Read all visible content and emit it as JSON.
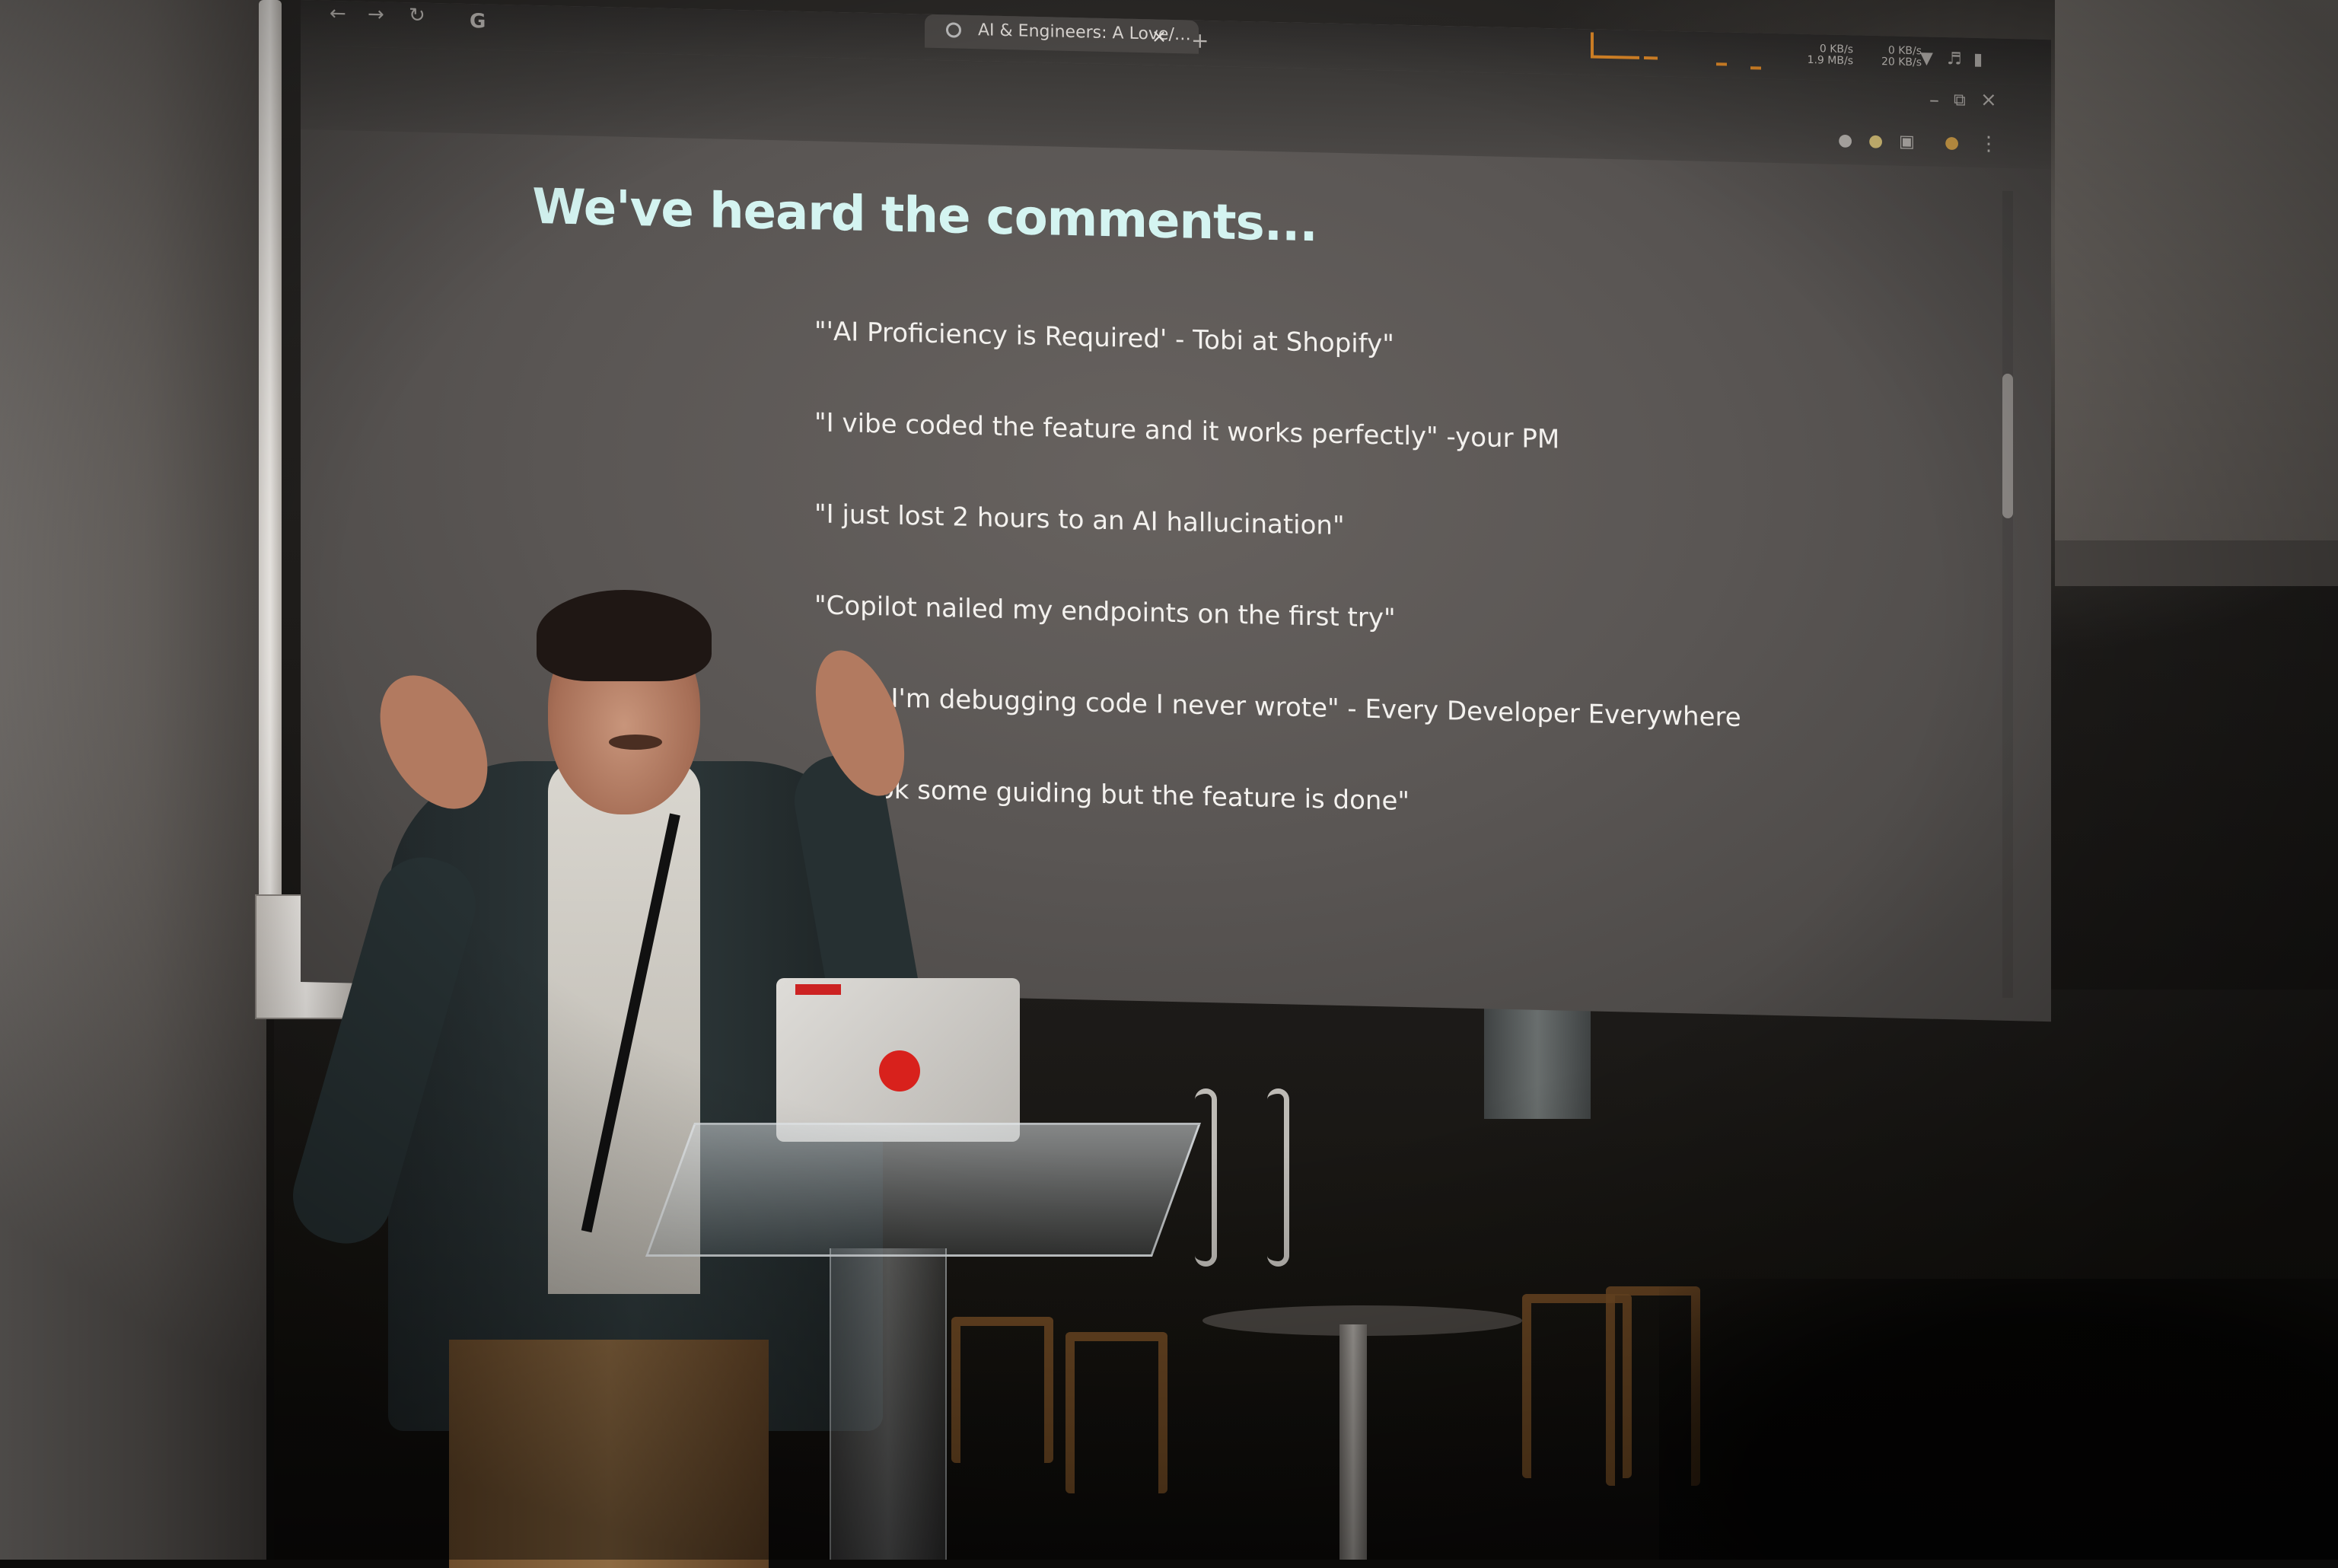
{
  "browser": {
    "tab_title": "AI & Engineers: A Love/…",
    "tab_close_glyph": "×",
    "new_tab_glyph": "+",
    "nav_icons": [
      "back-arrow-icon",
      "forward-arrow-icon",
      "reload-icon",
      "google-icon"
    ],
    "nav_glyphs": {
      "back": "←",
      "forward": "→",
      "reload": "↻",
      "google": "G"
    },
    "window_glyphs": {
      "minimize": "–",
      "restore": "⧉",
      "close": "×",
      "menu": "⋮"
    },
    "system_tray": {
      "net_down_1": "0 KB/s",
      "net_up_1": "1.9 MB/s",
      "net_down_2": "0 KB/s",
      "net_up_2": "20 KB/s"
    },
    "accent_color": "#e08a28"
  },
  "slide": {
    "title": "We've heard the comments...",
    "title_color": "#d4f4f1",
    "quotes": [
      "\"'AI Proficiency is Required' - Tobi at Shopify\"",
      "\"I vibe coded the feature and it works perfectly\" -your PM",
      "\"I just lost 2 hours to an AI hallucination\"",
      "\"Copilot nailed my endpoints on the first try\"",
      "\"Now I'm debugging code I never wrote\" - Every Developer Everywhere",
      "\"It took some guiding but the feature is done\""
    ]
  }
}
